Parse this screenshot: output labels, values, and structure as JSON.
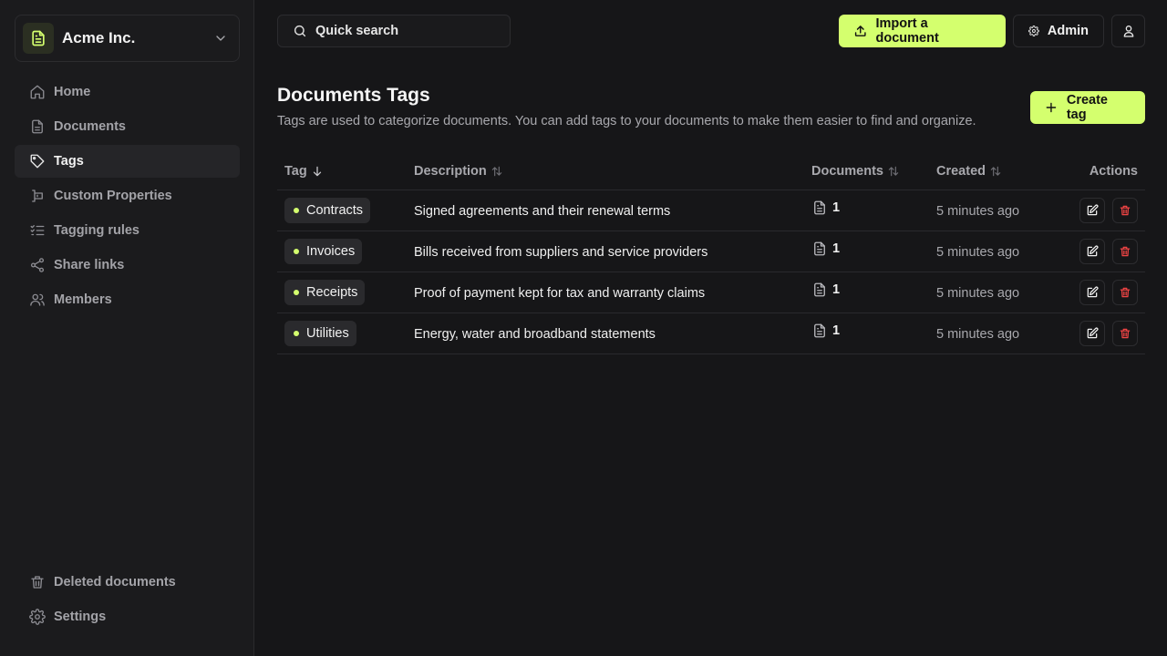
{
  "org": {
    "name": "Acme Inc."
  },
  "sidebar": {
    "items": [
      {
        "label": "Home",
        "icon": "home-icon",
        "active": false
      },
      {
        "label": "Documents",
        "icon": "file-icon",
        "active": false
      },
      {
        "label": "Tags",
        "icon": "tag-icon",
        "active": true
      },
      {
        "label": "Custom Properties",
        "icon": "custom-properties-icon",
        "active": false
      },
      {
        "label": "Tagging rules",
        "icon": "list-check-icon",
        "active": false
      },
      {
        "label": "Share links",
        "icon": "share-icon",
        "active": false
      },
      {
        "label": "Members",
        "icon": "users-icon",
        "active": false
      }
    ],
    "bottom_items": [
      {
        "label": "Deleted documents",
        "icon": "trash-icon"
      },
      {
        "label": "Settings",
        "icon": "gear-icon"
      }
    ]
  },
  "topbar": {
    "search_label": "Quick search",
    "import_label": "Import a document",
    "admin_label": "Admin"
  },
  "page": {
    "title": "Documents Tags",
    "description": "Tags are used to categorize documents. You can add tags to your documents to make them easier to find and organize.",
    "create_label": "Create tag"
  },
  "table": {
    "columns": {
      "tag": "Tag",
      "description": "Description",
      "documents": "Documents",
      "created": "Created",
      "actions": "Actions"
    },
    "rows": [
      {
        "name": "Contracts",
        "color": "#d4ff6e",
        "description": "Signed agreements and their renewal terms",
        "documents": "1",
        "created": "5 minutes ago"
      },
      {
        "name": "Invoices",
        "color": "#d4ff6e",
        "description": "Bills received from suppliers and service providers",
        "documents": "1",
        "created": "5 minutes ago"
      },
      {
        "name": "Receipts",
        "color": "#d4ff6e",
        "description": "Proof of payment kept for tax and warranty claims",
        "documents": "1",
        "created": "5 minutes ago"
      },
      {
        "name": "Utilities",
        "color": "#d4ff6e",
        "description": "Energy, water and broadband statements",
        "documents": "1",
        "created": "5 minutes ago"
      }
    ]
  },
  "colors": {
    "accent": "#d4ff6e",
    "danger": "#ef4444",
    "background": "#161618",
    "sidebar": "#1b1b1d"
  }
}
